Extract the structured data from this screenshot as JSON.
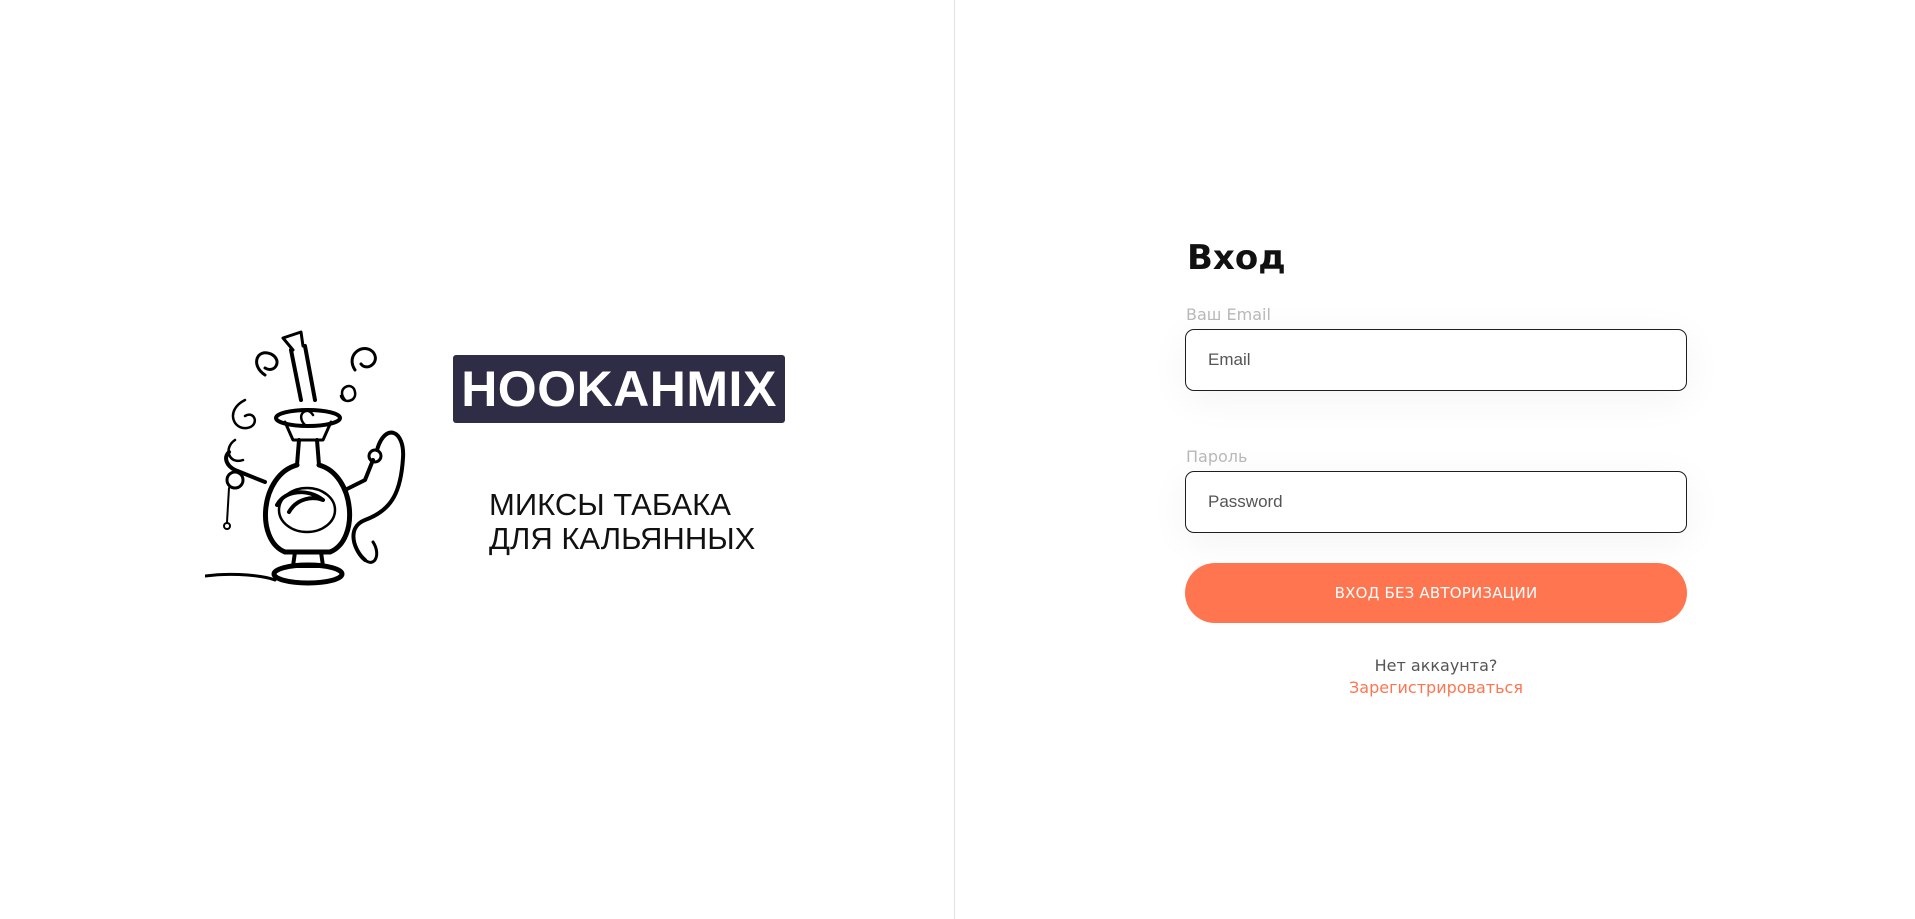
{
  "brand": {
    "name": "HOOKAHMIX",
    "tagline_line1": "МИКСЫ ТАБАКА",
    "tagline_line2": "ДЛЯ КАЛЬЯННЫХ",
    "logo_icon": "hookah-icon",
    "box_color": "#2e2d45"
  },
  "login_form": {
    "title": "Вход",
    "email_label": "Ваш Email",
    "email_placeholder": "Email",
    "email_value": "",
    "password_label": "Пароль",
    "password_placeholder": "Password",
    "password_value": "",
    "submit_label": "ВХОД БЕЗ АВТОРИЗАЦИИ",
    "no_account_text": "Нет аккаунта?",
    "register_link": "Зарегистрироваться",
    "accent_color": "#ff7550"
  }
}
